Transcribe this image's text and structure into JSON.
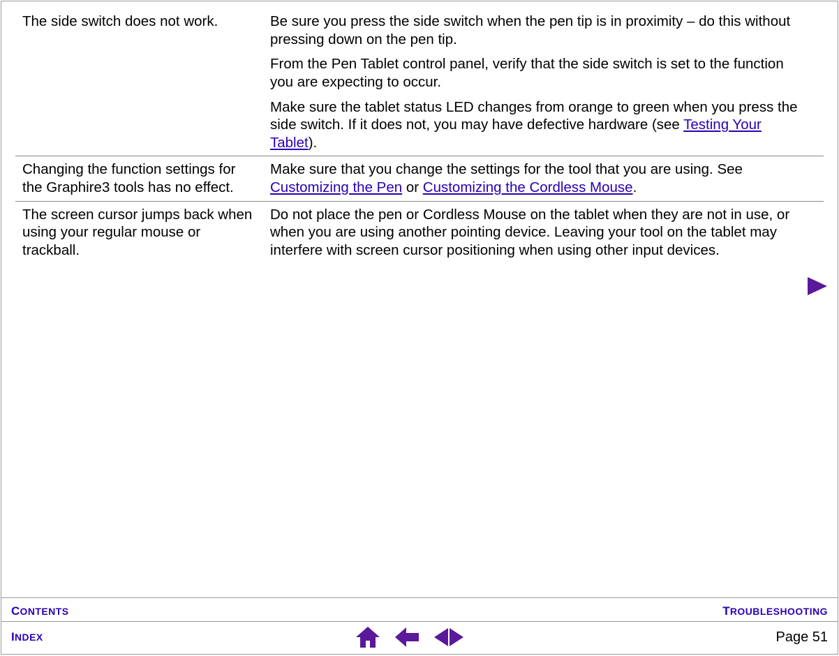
{
  "colors": {
    "link": "#2a00b3",
    "icon": "#5a189a"
  },
  "table": {
    "rows": [
      {
        "problem": "The side switch does not work.",
        "solution": [
          {
            "pre": "Be sure you press the side switch when the pen tip is in proximity – do this without pressing down on the pen tip."
          },
          {
            "pre": "From the Pen Tablet control panel, verify that the side switch is set to the function you are expecting to occur."
          },
          {
            "pre": "Make sure the tablet status LED changes from orange to green when you press the side switch.  If it does not, you may have defective hardware (see ",
            "link1": "Testing Your Tablet",
            "post1": ")."
          }
        ]
      },
      {
        "problem": "Changing the function settings for the Graphire3 tools has no effect.",
        "solution": [
          {
            "pre": "Make sure that you change the settings for the tool that you are using.  See ",
            "link1": "Customizing the Pen",
            "mid": " or ",
            "link2": "Customizing the Cordless Mouse",
            "post2": "."
          }
        ]
      },
      {
        "problem": "The screen cursor jumps back when using your regular mouse or trackball.",
        "solution": [
          {
            "pre": "Do not place the pen or Cordless Mouse on the tablet when they are not in use, or when you are using another pointing device.  Leaving your tool on the tablet may interfere with screen cursor positioning when using other input devices."
          }
        ]
      }
    ]
  },
  "footer": {
    "contents_label_first": "C",
    "contents_label_rest": "ONTENTS",
    "troubleshooting_label_first": "T",
    "troubleshooting_label_rest": "ROUBLESHOOTING",
    "index_label_first": "I",
    "index_label_rest": "NDEX",
    "page_label": "Page  51"
  }
}
